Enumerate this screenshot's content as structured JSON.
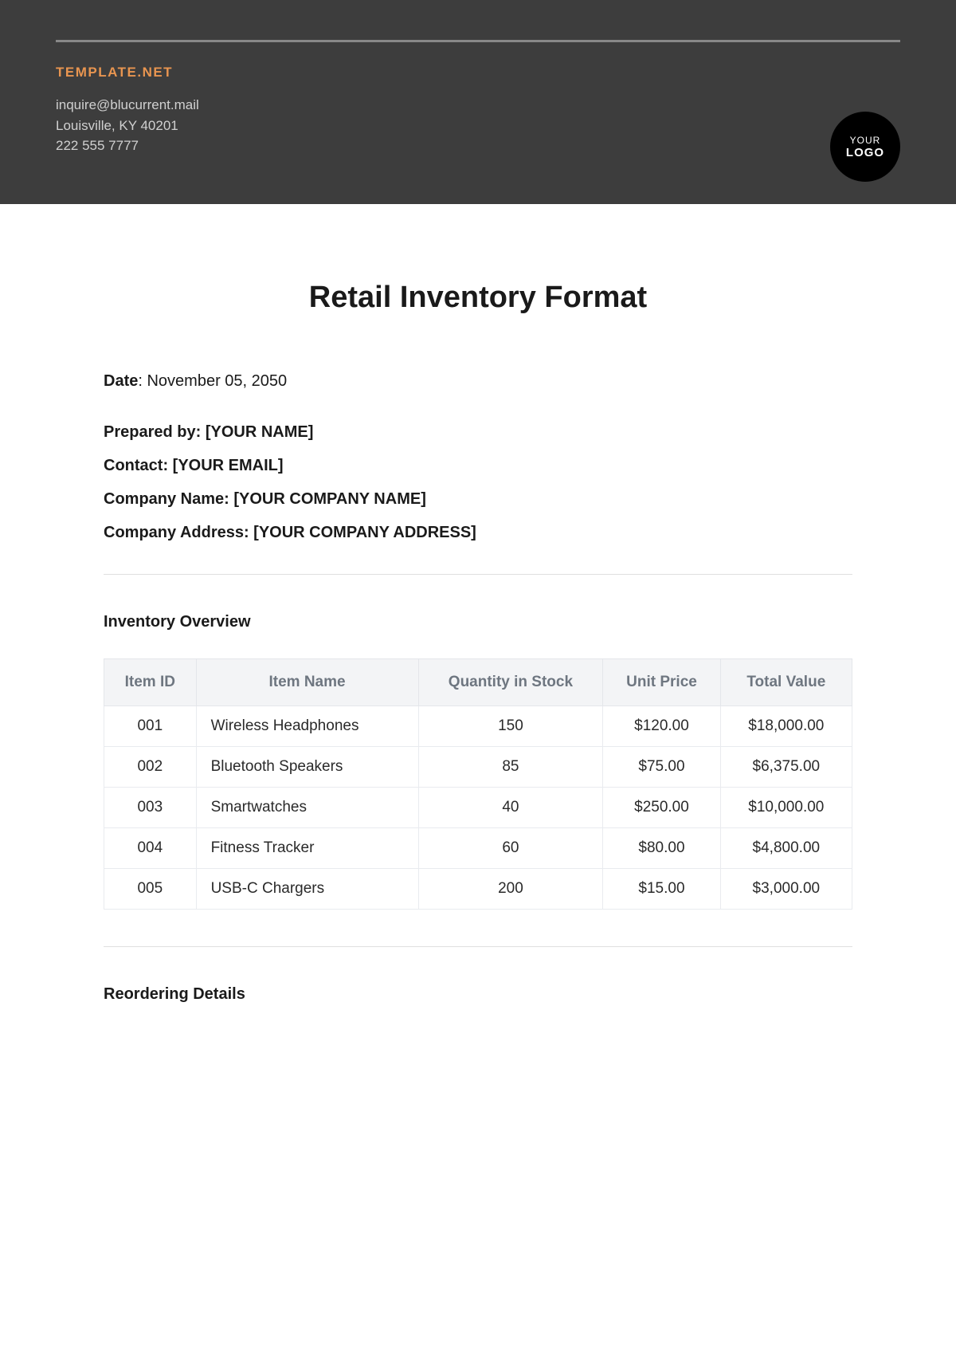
{
  "header": {
    "brand": "TEMPLATE.NET",
    "email": "inquire@blucurrent.mail",
    "address": "Louisville, KY 40201",
    "phone": "222 555 7777",
    "logo_line1": "YOUR",
    "logo_line2": "LOGO"
  },
  "title": "Retail Inventory Format",
  "meta": {
    "date_label": "Date",
    "date_value": ": November 05, 2050",
    "prepared_label": "Prepared by",
    "prepared_value": ": [YOUR NAME]",
    "contact_label": "Contact",
    "contact_value": ": [YOUR EMAIL]",
    "company_label": "Company Name",
    "company_value": ": [YOUR COMPANY NAME]",
    "address_label": "Company Address",
    "address_value": ": [YOUR COMPANY ADDRESS]"
  },
  "sections": {
    "overview": "Inventory Overview",
    "reordering": "Reordering Details"
  },
  "table": {
    "headers": {
      "id": "Item ID",
      "name": "Item Name",
      "qty": "Quantity in Stock",
      "price": "Unit Price",
      "total": "Total Value"
    },
    "rows": [
      {
        "id": "001",
        "name": "Wireless Headphones",
        "qty": "150",
        "price": "$120.00",
        "total": "$18,000.00"
      },
      {
        "id": "002",
        "name": "Bluetooth Speakers",
        "qty": "85",
        "price": "$75.00",
        "total": "$6,375.00"
      },
      {
        "id": "003",
        "name": "Smartwatches",
        "qty": "40",
        "price": "$250.00",
        "total": "$10,000.00"
      },
      {
        "id": "004",
        "name": "Fitness Tracker",
        "qty": "60",
        "price": "$80.00",
        "total": "$4,800.00"
      },
      {
        "id": "005",
        "name": "USB-C Chargers",
        "qty": "200",
        "price": "$15.00",
        "total": "$3,000.00"
      }
    ]
  }
}
